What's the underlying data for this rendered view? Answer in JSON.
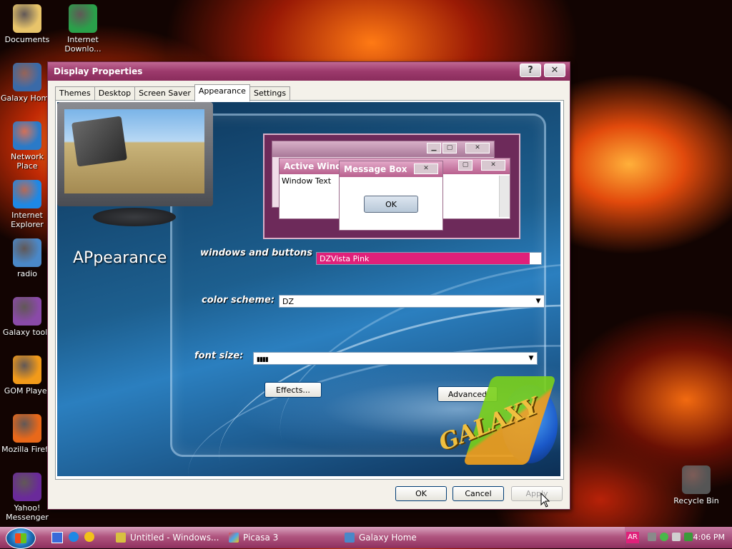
{
  "desktop": {
    "icons": [
      {
        "label": "Documents",
        "icon": "folder-icon",
        "color": "#e8c46a"
      },
      {
        "label": "Internet Downlo...",
        "icon": "download-icon",
        "color": "#2aa04a"
      },
      {
        "label": "Galaxy Home",
        "icon": "computer-icon",
        "color": "#3a6aa8"
      },
      {
        "label": "Network Place",
        "icon": "network-icon",
        "color": "#2a7ac8"
      },
      {
        "label": "Internet Explorer",
        "icon": "ie-icon",
        "color": "#1e88e5"
      },
      {
        "label": "radio",
        "icon": "radio-icon",
        "color": "#4a88c8"
      },
      {
        "label": "Galaxy tools",
        "icon": "tools-icon",
        "color": "#8a4aa8"
      },
      {
        "label": "GOM Player",
        "icon": "gom-icon",
        "color": "#f29a1a"
      },
      {
        "label": "Mozilla Firefo",
        "icon": "firefox-icon",
        "color": "#e8681a"
      },
      {
        "label": "Yahoo! Messenger",
        "icon": "yahoo-icon",
        "color": "#6a2a9a"
      },
      {
        "label": "Recycle Bin",
        "icon": "recycle-bin-icon",
        "color": "#555555"
      }
    ]
  },
  "dialog": {
    "title": "Display Properties",
    "help_glyph": "?",
    "close_glyph": "✕",
    "tabs": [
      {
        "label": "Themes"
      },
      {
        "label": "Desktop"
      },
      {
        "label": "Screen Saver"
      },
      {
        "label": "Appearance",
        "active": true
      },
      {
        "label": "Settings"
      }
    ],
    "heading": "APpearance",
    "preview": {
      "inactive_title": "",
      "active_title": "Active Windo",
      "window_text": "Window Text",
      "message_title": "Message Box",
      "ok_label": "OK"
    },
    "windows_and_buttons": {
      "label": "windows and buttons",
      "value": "DZVista Pink",
      "highlight": "#e0207a"
    },
    "color_scheme": {
      "label": "color scheme:",
      "value": "DZ"
    },
    "font_size": {
      "label": "font size:",
      "value": "▮▮▮▮"
    },
    "effects_label": "Effects...",
    "advanced_label": "Advanced",
    "ok_label": "OK",
    "cancel_label": "Cancel",
    "apply_label": "Apply",
    "logo_text": "GALAXY"
  },
  "taskbar": {
    "items": [
      {
        "label": "Untitled - Windows..."
      },
      {
        "label": "Picasa 3"
      },
      {
        "label": "Galaxy Home"
      }
    ],
    "lang": "AR",
    "clock": "4:06 PM"
  }
}
